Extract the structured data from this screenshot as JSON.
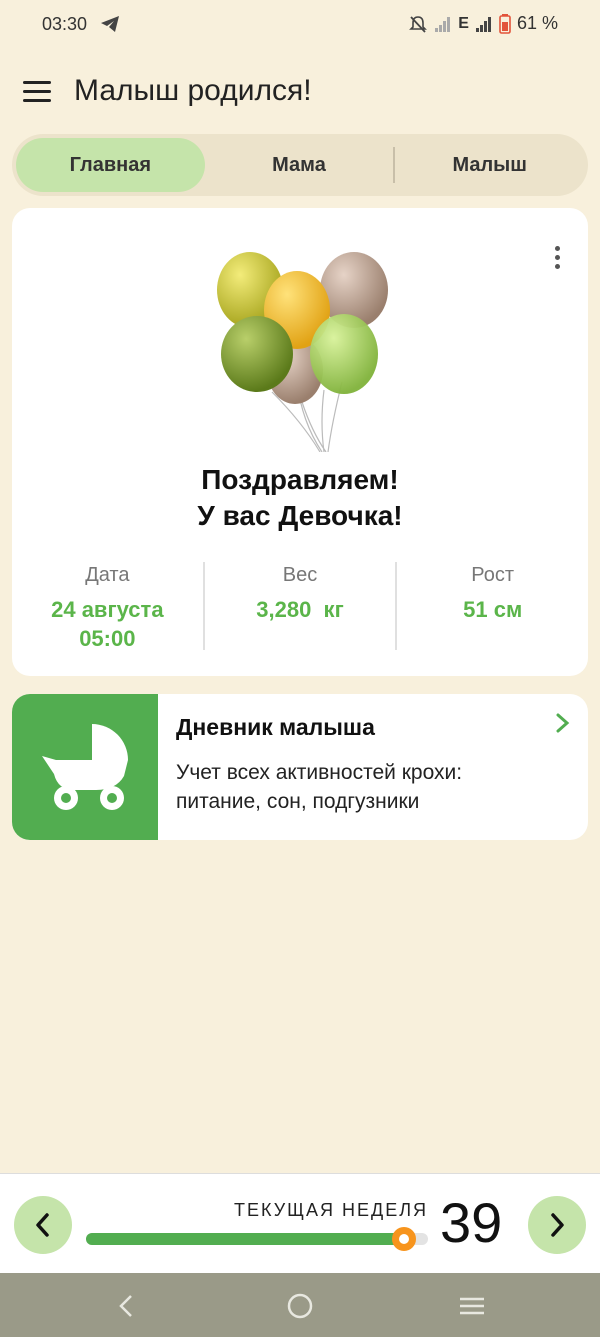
{
  "status_bar": {
    "time": "03:30",
    "network_type": "E",
    "battery": "61 %",
    "icons": [
      "telegram-icon",
      "mute-icon",
      "signal-icon",
      "signal-icon",
      "battery-icon"
    ]
  },
  "app_bar": {
    "title": "Малыш родился!",
    "menu_icon": "hamburger-menu-icon"
  },
  "tabs": [
    {
      "label": "Главная",
      "active": true
    },
    {
      "label": "Мама",
      "active": false
    },
    {
      "label": "Малыш",
      "active": false
    }
  ],
  "hero": {
    "line1": "Поздравляем!",
    "line2": "У вас Девочка!",
    "more_icon": "more-vertical-icon",
    "stats": [
      {
        "label": "Дата",
        "value_line1": "24 августа",
        "value_line2": "05:00"
      },
      {
        "label": "Вес",
        "value_line1": "3,280  кг",
        "value_line2": ""
      },
      {
        "label": "Рост",
        "value_line1": "51 см",
        "value_line2": ""
      }
    ]
  },
  "diary": {
    "title": "Дневник малыша",
    "description": "Учет всех активностей крохи: питание, сон, подгузники",
    "icon": "stroller-icon"
  },
  "week": {
    "label": "ТЕКУЩАЯ НЕДЕЛЯ",
    "number": "39",
    "progress_fraction": 0.93
  },
  "colors": {
    "background": "#f8f0dc",
    "accent_green": "#52ad50",
    "tab_active": "#c5e4aa",
    "slider_thumb": "#f7941d"
  }
}
